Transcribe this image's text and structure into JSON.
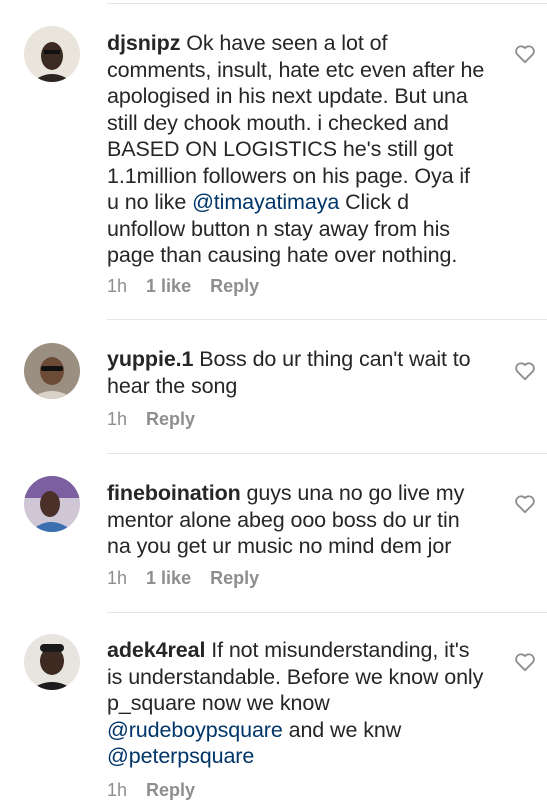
{
  "comments": [
    {
      "username": "djsnipz",
      "text_before": "Ok have seen a lot of comments, insult, hate etc even after he apologised in his next update. But una still dey chook mouth. i checked and  BASED ON LOGISTICS he's still got 1.1million followers on his page. Oya  if u no like ",
      "mention": "@timayatimaya",
      "text_after": " Click d unfollow button n stay away from his page than causing hate over nothing.",
      "time": "1h",
      "likes": "1 like",
      "reply": "Reply",
      "avatar_icon": "user-avatar-icon",
      "like_icon": "heart-icon"
    },
    {
      "username": "yuppie.1",
      "text": "Boss do ur thing can't wait to hear the song",
      "time": "1h",
      "reply": "Reply",
      "avatar_icon": "user-avatar-icon",
      "like_icon": "heart-icon"
    },
    {
      "username": "fineboination",
      "text": "guys una no go live my mentor alone abeg ooo boss do ur tin na you get ur music no mind dem jor",
      "time": "1h",
      "likes": "1 like",
      "reply": "Reply",
      "avatar_icon": "user-avatar-icon",
      "like_icon": "heart-icon"
    },
    {
      "username": "adek4real",
      "text_before": "If not misunderstanding, it's is understandable. Before we know only p_square now we know ",
      "mention1": "@rudeboypsquare",
      "text_middle": " and we knw ",
      "mention2": "@peterpsquare",
      "time": "1h",
      "reply": "Reply",
      "avatar_icon": "user-avatar-icon",
      "like_icon": "heart-icon"
    }
  ],
  "colors": {
    "mention": "#003569",
    "meta": "#8e8e8e",
    "text": "#262626"
  }
}
